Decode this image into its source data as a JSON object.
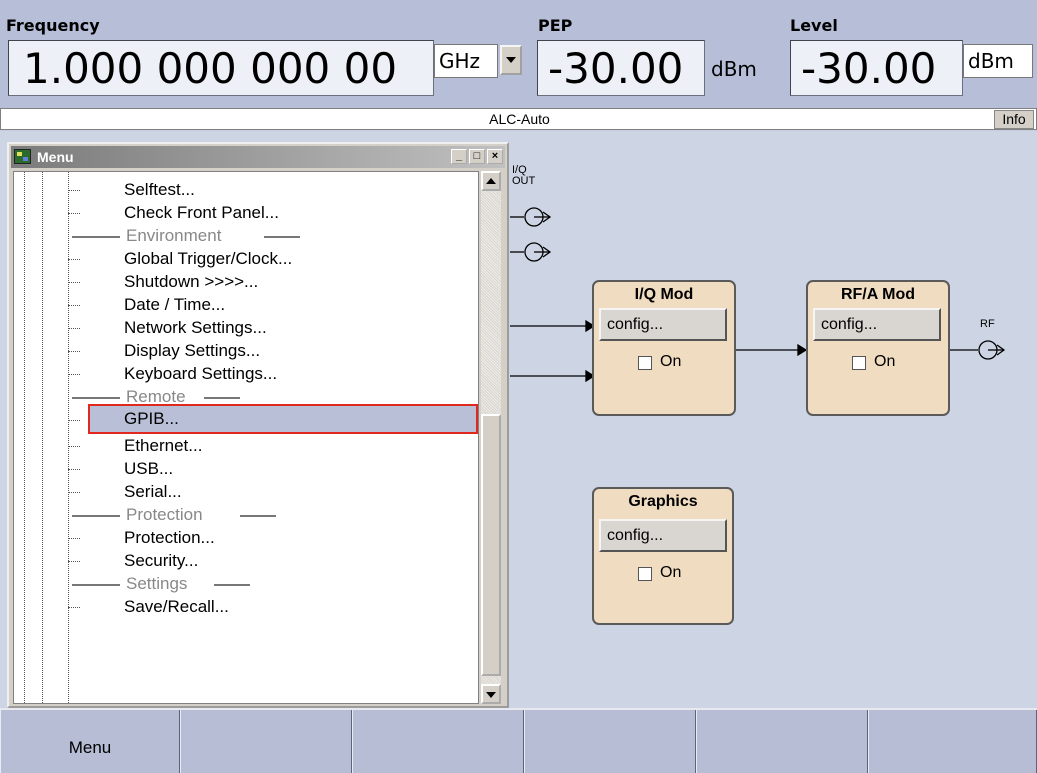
{
  "header": {
    "frequency_label": "Frequency",
    "frequency_value": "1.000 000 000 00",
    "frequency_unit": "GHz",
    "pep_label": "PEP",
    "pep_value": "-30.00",
    "pep_unit": "dBm",
    "level_label": "Level",
    "level_value": "-30.00",
    "level_unit": "dBm"
  },
  "status": {
    "text": "ALC-Auto",
    "info_label": "Info"
  },
  "menu_window": {
    "title": "Menu",
    "minimize": "_",
    "maximize": "□",
    "close": "×",
    "items": [
      {
        "label": "Selftest...",
        "type": "item"
      },
      {
        "label": "Check Front Panel...",
        "type": "item"
      },
      {
        "label": "Environment",
        "type": "separator"
      },
      {
        "label": "Global Trigger/Clock...",
        "type": "item"
      },
      {
        "label": "Shutdown >>>>...",
        "type": "item"
      },
      {
        "label": "Date / Time...",
        "type": "item"
      },
      {
        "label": "Network Settings...",
        "type": "item"
      },
      {
        "label": "Display Settings...",
        "type": "item"
      },
      {
        "label": "Keyboard Settings...",
        "type": "item"
      },
      {
        "label": "Remote",
        "type": "separator"
      },
      {
        "label": "GPIB...",
        "type": "item",
        "selected": true
      },
      {
        "label": "Ethernet...",
        "type": "item"
      },
      {
        "label": "USB...",
        "type": "item"
      },
      {
        "label": "Serial...",
        "type": "item"
      },
      {
        "label": "Protection",
        "type": "separator"
      },
      {
        "label": "Protection...",
        "type": "item"
      },
      {
        "label": "Security...",
        "type": "item"
      },
      {
        "label": "Settings",
        "type": "separator"
      },
      {
        "label": "Save/Recall...",
        "type": "item"
      }
    ]
  },
  "diagram": {
    "iq_out_label_line1": "I/Q",
    "iq_out_label_line2": "OUT",
    "rf_label": "RF",
    "blocks": {
      "iq_mod": {
        "title": "I/Q Mod",
        "config_label": "config...",
        "on_label": "On",
        "checked": false
      },
      "rf_mod": {
        "title": "RF/A Mod",
        "config_label": "config...",
        "on_label": "On",
        "checked": false
      },
      "graphics": {
        "title": "Graphics",
        "config_label": "config...",
        "on_label": "On",
        "checked": false
      }
    }
  },
  "softkeys": [
    "Menu",
    "",
    "",
    "",
    "",
    ""
  ],
  "colors": {
    "selection_border": "#e0281e",
    "block_fill": "#f0dcc0",
    "canvas": "#cdd5e4"
  }
}
